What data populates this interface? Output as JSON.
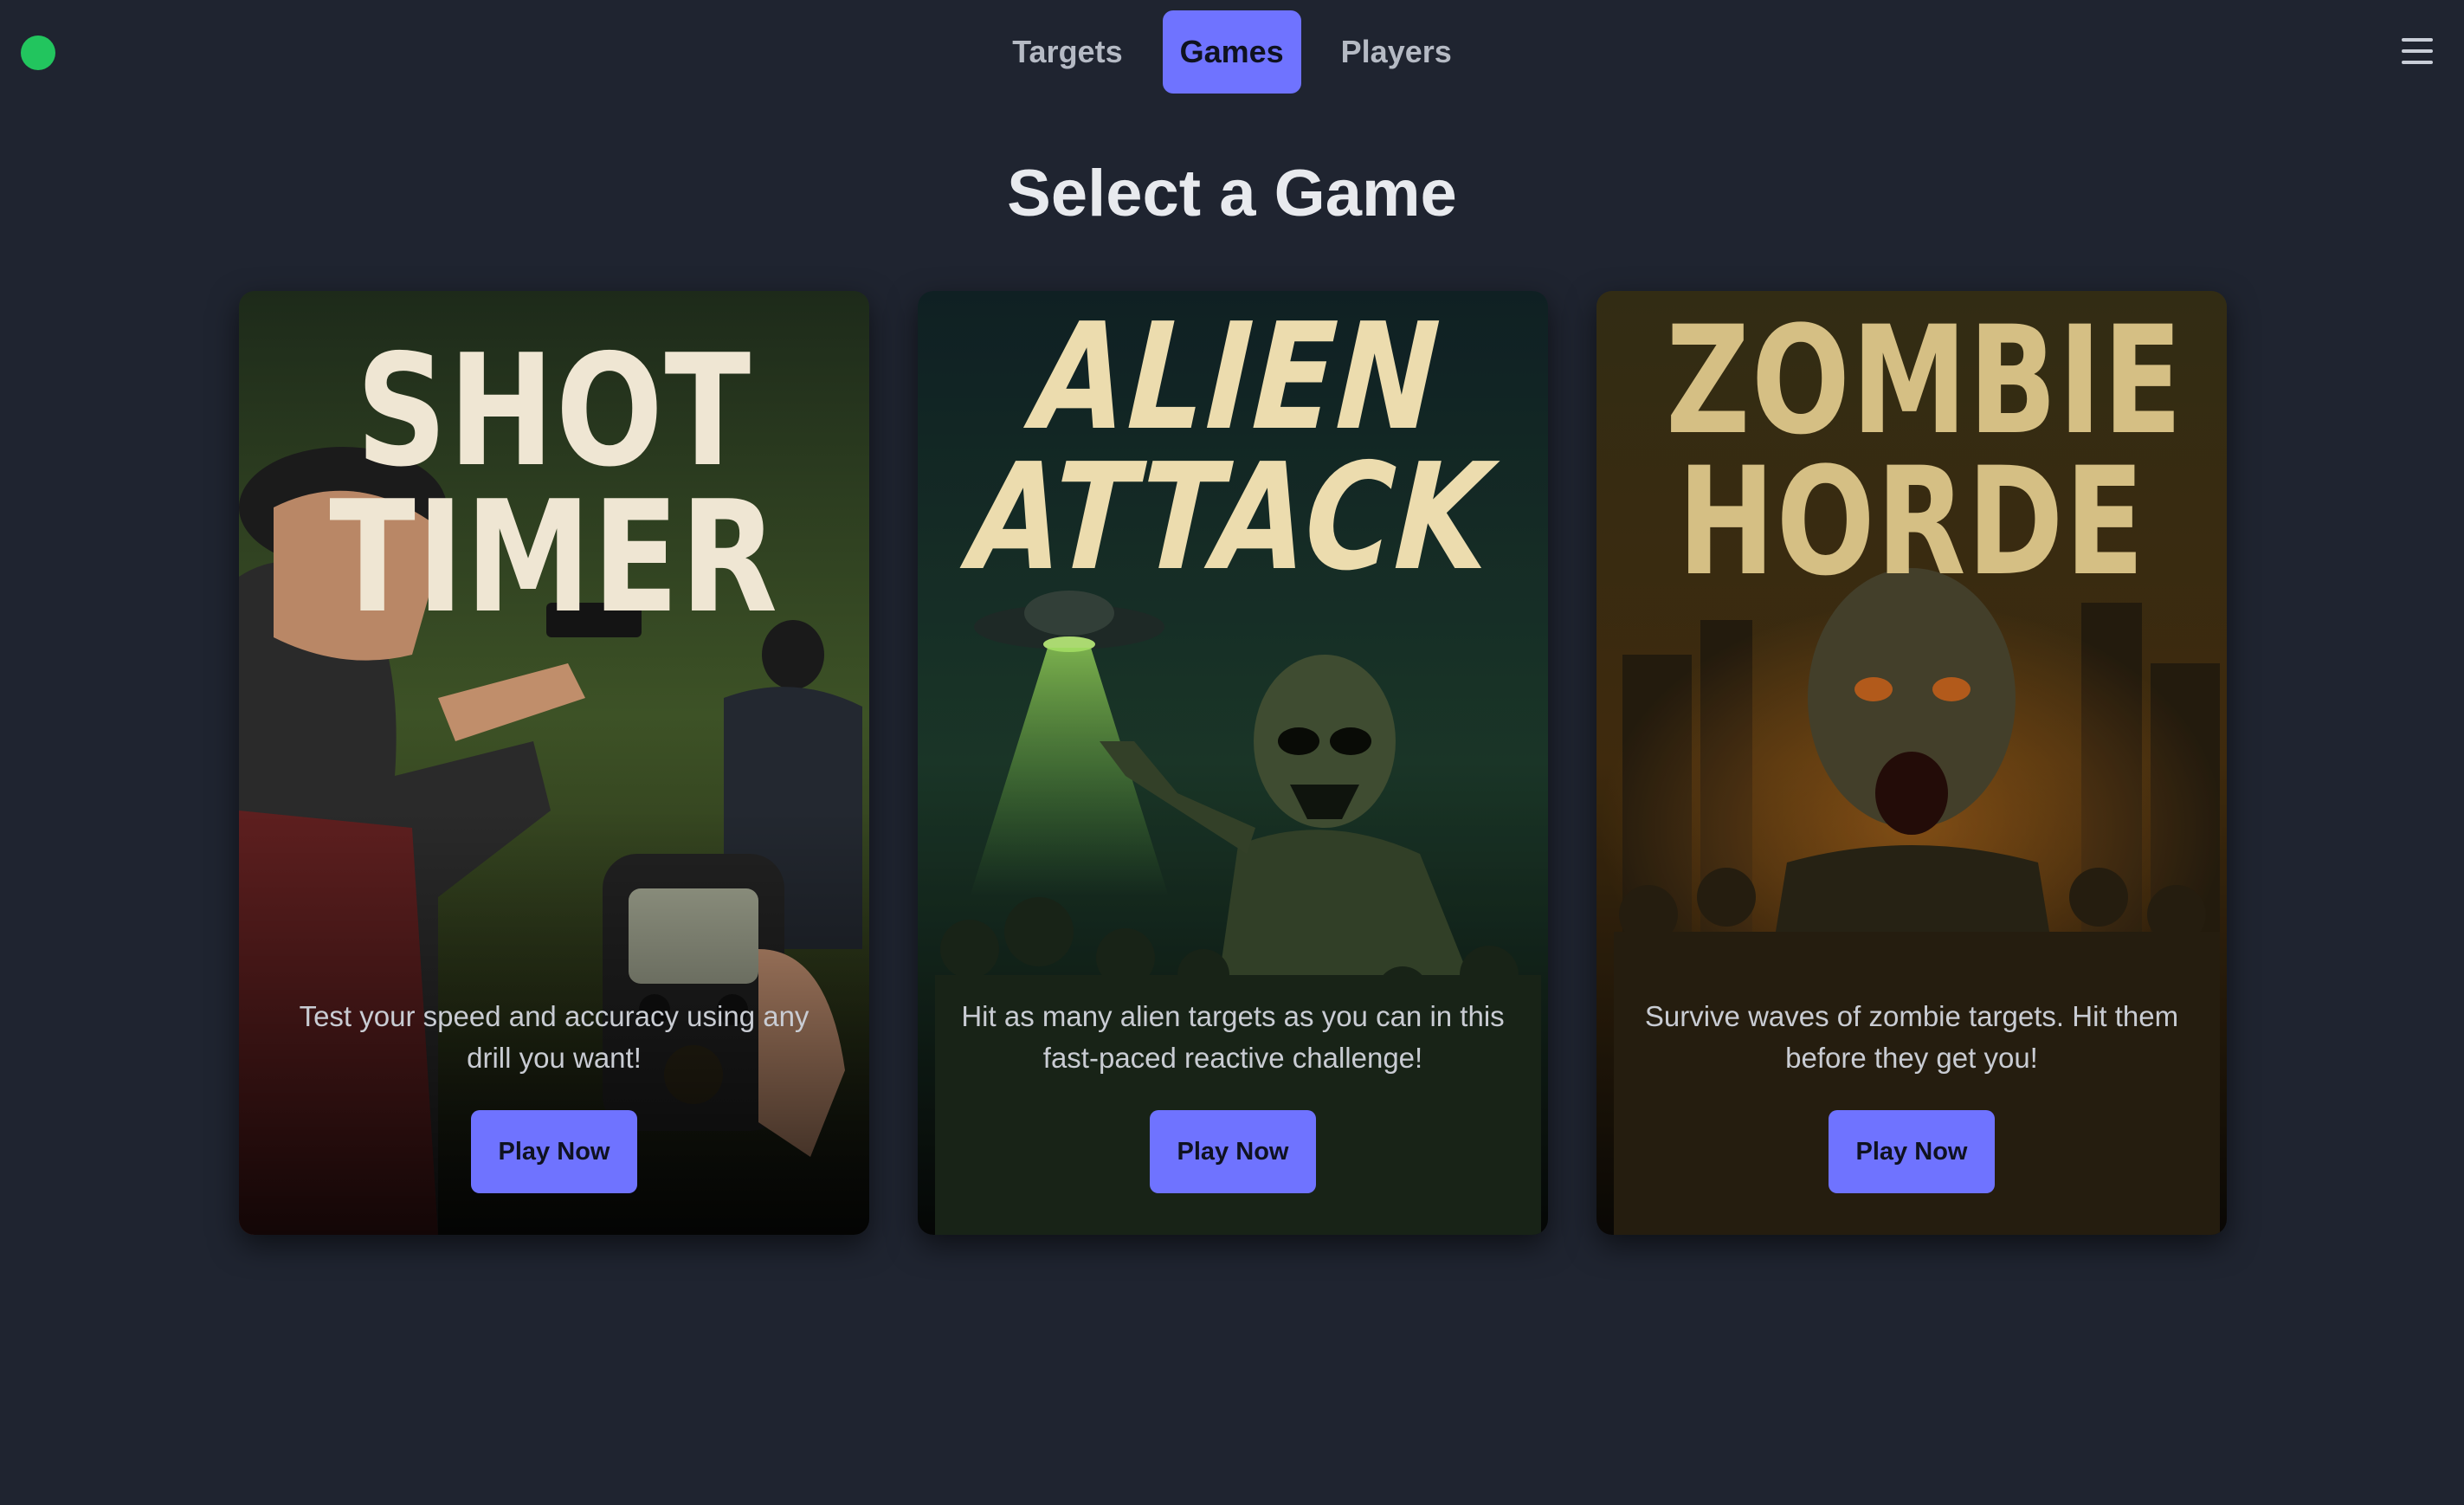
{
  "header": {
    "status_color": "#22c55e",
    "tabs": [
      {
        "label": "Targets",
        "active": false
      },
      {
        "label": "Games",
        "active": true
      },
      {
        "label": "Players",
        "active": false
      }
    ],
    "menu_icon": "hamburger-menu-icon"
  },
  "main": {
    "title": "Select a Game",
    "games": [
      {
        "poster_lines": [
          "SHOT",
          "TIMER"
        ],
        "description": "Test your speed and accuracy using any drill you want!",
        "button": "Play Now"
      },
      {
        "poster_lines": [
          "ALIEN",
          "ATTACK"
        ],
        "description": "Hit as many alien targets as you can in this fast-paced reactive challenge!",
        "button": "Play Now"
      },
      {
        "poster_lines": [
          "ZOMBIE",
          "HORDE"
        ],
        "description": "Survive waves of zombie targets. Hit them before they get you!",
        "button": "Play Now"
      }
    ]
  },
  "colors": {
    "accent": "#6f73ff",
    "background": "#1f2430"
  }
}
